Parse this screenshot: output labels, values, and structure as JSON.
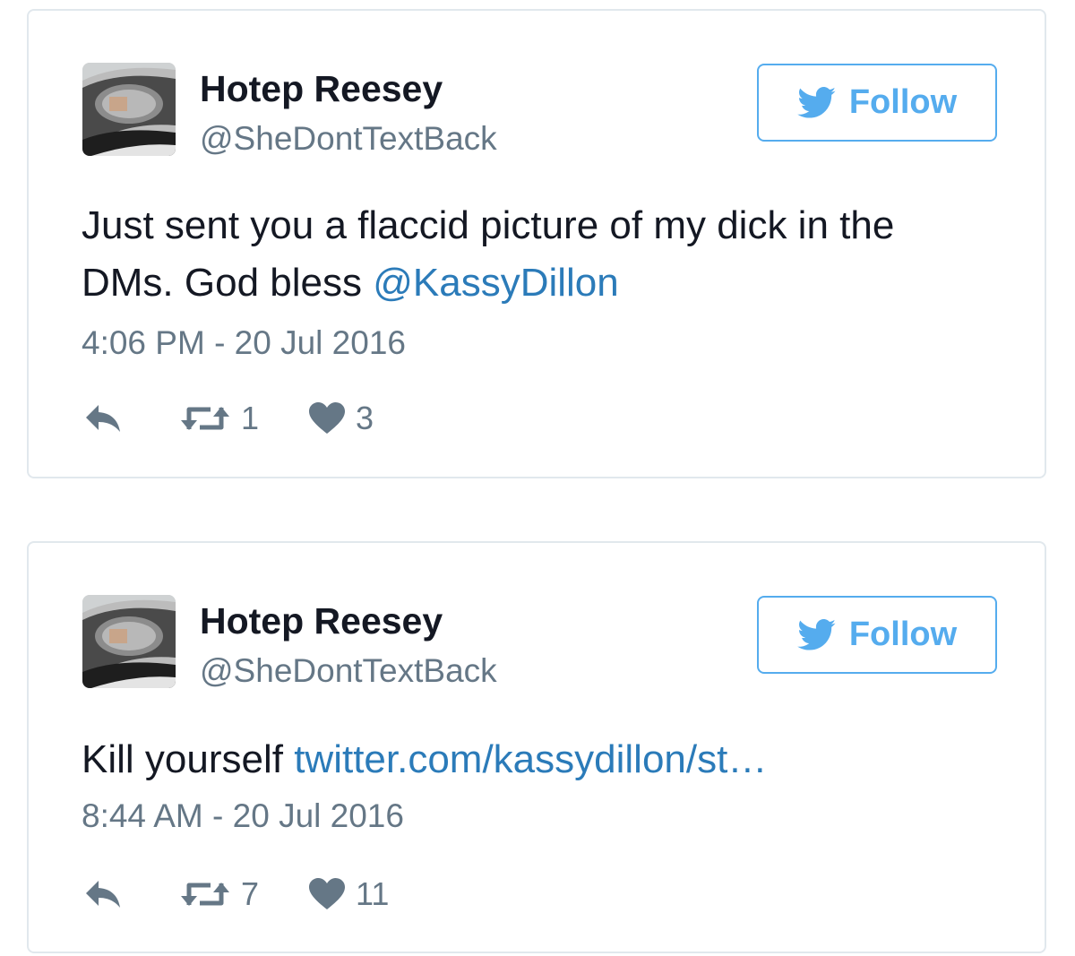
{
  "colors": {
    "name": "#141823",
    "meta": "#657786",
    "link": "#2b7bb9",
    "brand": "#55acee",
    "border": "#e1e8ed"
  },
  "tweets": [
    {
      "author": {
        "display_name": "Hotep Reesey",
        "handle": "@SheDontTextBack",
        "avatar_icon": "car-side-mirror-photo"
      },
      "follow_label": "Follow",
      "follow_icon": "twitter-bird-icon",
      "text_before": "Just sent you a flaccid picture of my dick in the DMs. God bless ",
      "link_text": "@KassyDillon",
      "text_after": "",
      "timestamp": "4:06 PM - 20 Jul 2016",
      "retweet_count": "1",
      "like_count": "3"
    },
    {
      "author": {
        "display_name": "Hotep Reesey",
        "handle": "@SheDontTextBack",
        "avatar_icon": "car-side-mirror-photo"
      },
      "follow_label": "Follow",
      "follow_icon": "twitter-bird-icon",
      "text_before": "Kill yourself ",
      "link_text": "twitter.com/kassydillon/st…",
      "text_after": "",
      "timestamp": "8:44 AM - 20 Jul 2016",
      "retweet_count": "7",
      "like_count": "11"
    }
  ]
}
